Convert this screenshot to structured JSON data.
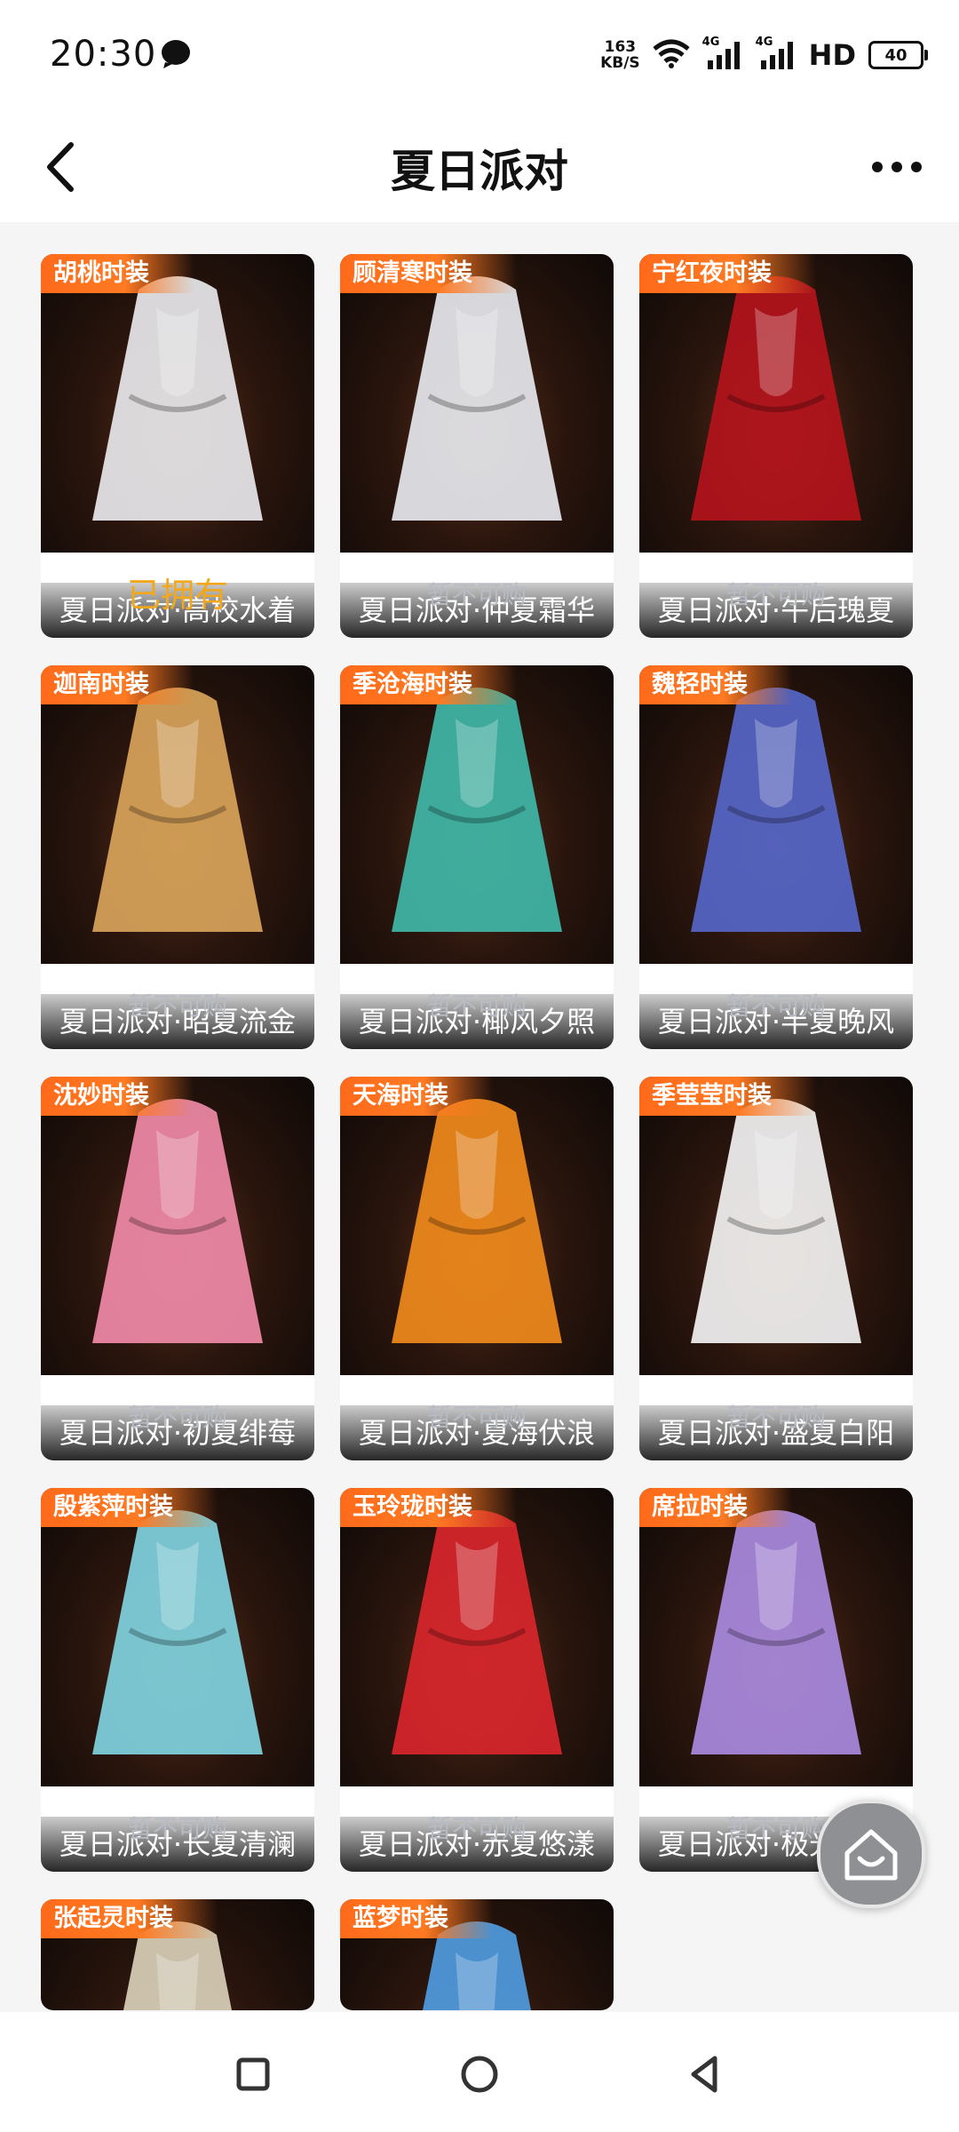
{
  "status_bar": {
    "time": "20:30",
    "net_speed_value": "163",
    "net_speed_unit": "KB/S",
    "network_type_1": "4G",
    "network_type_2": "4G",
    "hd_label": "HD",
    "battery": "40"
  },
  "header": {
    "title": "夏日派对"
  },
  "cards": [
    {
      "character": "胡桃时装",
      "outfit": "夏日派对·高校水着",
      "status": "已拥有"
    },
    {
      "character": "顾清寒时装",
      "outfit": "夏日派对·仲夏霜华",
      "status": "暂不可购"
    },
    {
      "character": "宁红夜时装",
      "outfit": "夏日派对·午后瑰夏",
      "status": "暂不可购"
    },
    {
      "character": "迦南时装",
      "outfit": "夏日派对·昭夏流金",
      "status": "暂不可购"
    },
    {
      "character": "季沧海时装",
      "outfit": "夏日派对·椰风夕照",
      "status": "暂不可购"
    },
    {
      "character": "魏轻时装",
      "outfit": "夏日派对·半夏晚风",
      "status": "暂不可购"
    },
    {
      "character": "沈妙时装",
      "outfit": "夏日派对·初夏绯莓",
      "status": "暂不可购"
    },
    {
      "character": "天海时装",
      "outfit": "夏日派对·夏海伏浪",
      "status": "暂不可购"
    },
    {
      "character": "季莹莹时装",
      "outfit": "夏日派对·盛夏白阳",
      "status": "暂不可购"
    },
    {
      "character": "殷紫萍时装",
      "outfit": "夏日派对·长夏清澜",
      "status": "暂不可购"
    },
    {
      "character": "玉玲珑时装",
      "outfit": "夏日派对·赤夏悠漾",
      "status": "暂不可购"
    },
    {
      "character": "席拉时装",
      "outfit": "夏日派对·极光夏夜",
      "status": "暂不可购"
    },
    {
      "character": "张起灵时装"
    },
    {
      "character": "蓝梦时装"
    }
  ],
  "colors": {
    "tag_orange": "#ff6a1a",
    "owned_gold": "#f2a81d",
    "unavailable_gray": "#b7bbc4",
    "outfit_colors": [
      "#e8e8ec",
      "#e6e8ee",
      "#b3141c",
      "#d8a45a",
      "#3fb7a8",
      "#5566c8",
      "#f08aa8",
      "#f08a1c",
      "#f2f2f2",
      "#7fd3e0",
      "#d8262c",
      "#a98ae0",
      "#d9d0b8",
      "#4f9be0"
    ]
  },
  "icons": {
    "back": "chevron-left-icon",
    "more": "more-horizontal-icon",
    "home_float": "home-icon",
    "nav_recent": "square-icon",
    "nav_home": "circle-icon",
    "nav_back": "triangle-left-icon"
  }
}
